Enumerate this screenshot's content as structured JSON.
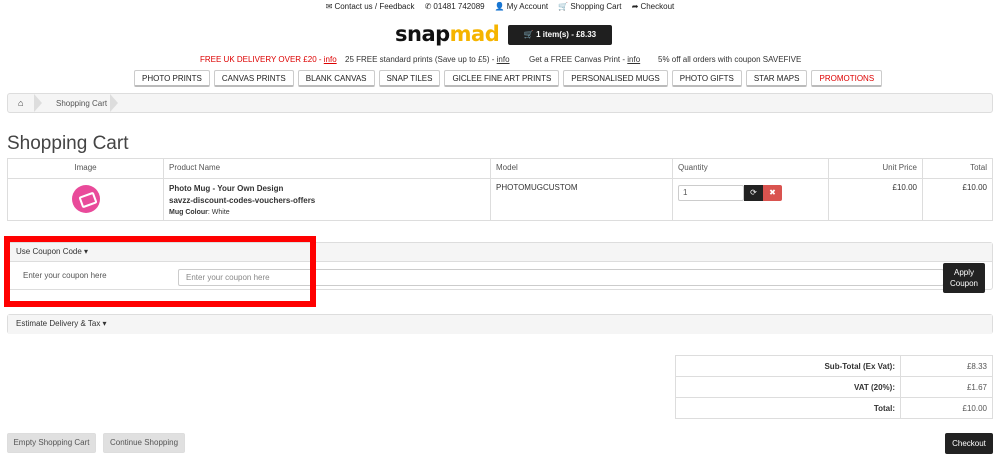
{
  "top_links": [
    {
      "icon": "envelope-icon",
      "glyph": "✉",
      "label": "Contact us / Feedback"
    },
    {
      "icon": "phone-icon",
      "glyph": "✆",
      "label": "01481 742089"
    },
    {
      "icon": "user-icon",
      "glyph": "👤",
      "label": "My Account"
    },
    {
      "icon": "cart-icon",
      "glyph": "🛒",
      "label": "Shopping Cart"
    },
    {
      "icon": "share-icon",
      "glyph": "➦",
      "label": "Checkout"
    }
  ],
  "logo": {
    "part1": "snap",
    "part2": "mad"
  },
  "cart_button": "🛒 1 item(s) - £8.33",
  "promos": [
    {
      "text": "FREE UK DELIVERY OVER £20 - ",
      "link": "info"
    },
    {
      "text": "25 FREE standard prints (Save up to £5) - ",
      "link": "info"
    },
    {
      "text": "Get a FREE Canvas Print - ",
      "link": "info"
    },
    {
      "text": "5% off all orders with coupon SAVEFIVE",
      "link": ""
    }
  ],
  "nav": [
    "PHOTO PRINTS",
    "CANVAS PRINTS",
    "BLANK CANVAS",
    "SNAP TILES",
    "GICLEE FINE ART PRINTS",
    "PERSONALISED MUGS",
    "PHOTO GIFTS",
    "STAR MAPS",
    "PROMOTIONS"
  ],
  "breadcrumb": {
    "home_glyph": "⌂",
    "current": "Shopping Cart"
  },
  "page_title": "Shopping Cart",
  "cart_table": {
    "headers": [
      "Image",
      "Product Name",
      "Model",
      "Quantity",
      "Unit Price",
      "Total"
    ],
    "row": {
      "name_line1": "Photo Mug - Your Own Design",
      "name_line2": "savzz-discount-codes-vouchers-offers",
      "option_label": "Mug Colour",
      "option_value": ": White",
      "model": "PHOTOMUGCUSTOM",
      "quantity": "1",
      "unit_price": "£10.00",
      "total": "£10.00"
    }
  },
  "coupon": {
    "heading": "Use Coupon Code ▾",
    "label": "Enter your coupon here",
    "placeholder": "Enter your coupon here",
    "apply_line1": "Apply",
    "apply_line2": "Coupon"
  },
  "delivery": {
    "heading": "Estimate Delivery & Tax ▾"
  },
  "totals": [
    {
      "label": "Sub-Total (Ex Vat):",
      "value": "£8.33"
    },
    {
      "label": "VAT (20%):",
      "value": "£1.67"
    },
    {
      "label": "Total:",
      "value": "£10.00"
    }
  ],
  "buttons": {
    "empty": "Empty Shopping Cart",
    "continue": "Continue Shopping",
    "checkout": "Checkout"
  },
  "colors": {
    "accent": "#f5b400",
    "highlight": "#ff0000",
    "promo_red": "#dd0000"
  }
}
